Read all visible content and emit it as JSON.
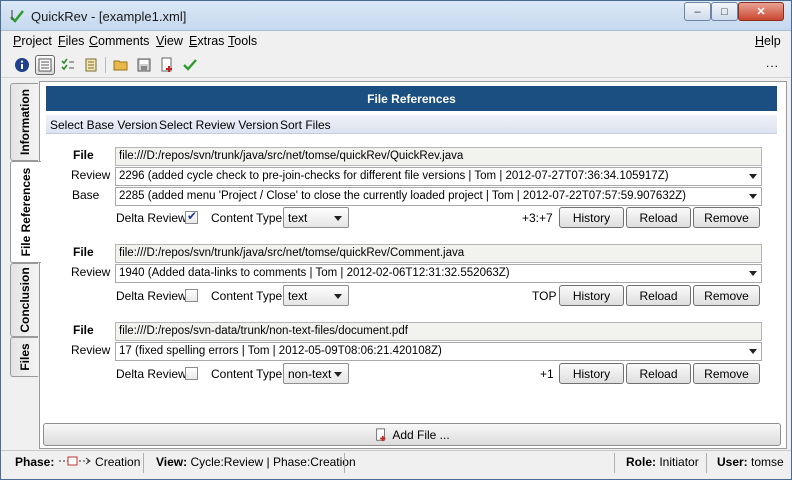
{
  "window": {
    "title": "QuickRev - [example1.xml]",
    "minimize": "–",
    "maximize": "□",
    "close": "✕"
  },
  "menu": [
    {
      "mnemonic": "P",
      "rest": "roject"
    },
    {
      "mnemonic": "F",
      "rest": "iles"
    },
    {
      "mnemonic": "C",
      "rest": "omments"
    },
    {
      "mnemonic": "V",
      "rest": "iew"
    },
    {
      "mnemonic": "E",
      "rest": "xtras"
    },
    {
      "mnemonic": "T",
      "rest": "ools"
    },
    {
      "mnemonic": "H",
      "rest": "elp"
    }
  ],
  "toolbar": {
    "more": "..."
  },
  "tabs": [
    "Information",
    "File References",
    "Conclusion",
    "Files"
  ],
  "panel": {
    "header": "File References",
    "actions": [
      "Select Base Version",
      "Select Review Version",
      "Sort Files"
    ]
  },
  "labels": {
    "file": "File",
    "review": "Review",
    "base": "Base",
    "delta_review": "Delta Review",
    "content_type": "Content Type",
    "history": "History",
    "reload": "Reload",
    "remove": "Remove"
  },
  "files": [
    {
      "path": "file:///D:/repos/svn/trunk/java/src/net/tomse/quickRev/QuickRev.java",
      "review": "2296 (added cycle check to pre-join-checks for different file versions | Tom | 2012-07-27T07:36:34.105917Z)",
      "base": "2285 (added menu 'Project / Close' to close the currently loaded project | Tom | 2012-07-22T07:57:59.907632Z)",
      "delta_checked": true,
      "content_type": "text",
      "status": "+3:+7"
    },
    {
      "path": "file:///D:/repos/svn/trunk/java/src/net/tomse/quickRev/Comment.java",
      "review": "1940 (Added data-links to comments | Tom | 2012-02-06T12:31:32.552063Z)",
      "delta_checked": false,
      "content_type": "text",
      "status": "TOP"
    },
    {
      "path": "file:///D:/repos/svn-data/trunk/non-text-files/document.pdf",
      "review": "17 (fixed spelling errors | Tom | 2012-05-09T08:06:21.420108Z)",
      "delta_checked": false,
      "content_type": "non-text",
      "status": "+1"
    }
  ],
  "add_file": "Add File ...",
  "statusbar": {
    "phase_label": "Phase:",
    "phase_value": "Creation",
    "view_label": "View:",
    "view_value": "Cycle:Review | Phase:Creation",
    "role_label": "Role:",
    "role_value": "Initiator",
    "user_label": "User:",
    "user_value": "tomse"
  },
  "colors": {
    "header_bg": "#1b4f82",
    "accent": "#1d3e8a"
  }
}
